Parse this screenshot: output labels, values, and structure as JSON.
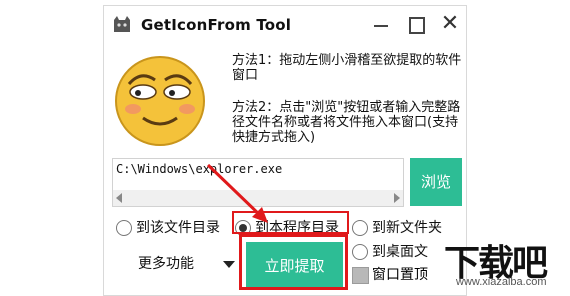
{
  "window": {
    "title": "GetIconFrom Tool",
    "close_glyph": "✕"
  },
  "instructions": {
    "method1": "方法1：拖动左侧小滑稽至欲提取的软件窗口",
    "method2": "方法2：点击\"浏览\"按钮或者输入完整路径文件名称或者将文件拖入本窗口(支持快捷方式拖入)"
  },
  "path_input": {
    "value": "C:\\Windows\\explorer.exe"
  },
  "buttons": {
    "browse": "浏览",
    "extract": "立即提取",
    "more": "更多功能"
  },
  "options": {
    "radio_items": [
      {
        "label": "到该文件目录",
        "selected": false
      },
      {
        "label": "到本程序目录",
        "selected": true
      },
      {
        "label": "到新文件夹",
        "selected": false
      },
      {
        "label": "到桌面文",
        "selected": false
      }
    ],
    "pin_window": {
      "label": "窗口置顶",
      "checked": false
    }
  },
  "watermark": {
    "brand": "下载吧",
    "url": "www.xiazaiba.com"
  },
  "colors": {
    "accent": "#2dbd95",
    "highlight": "#e0191b"
  }
}
